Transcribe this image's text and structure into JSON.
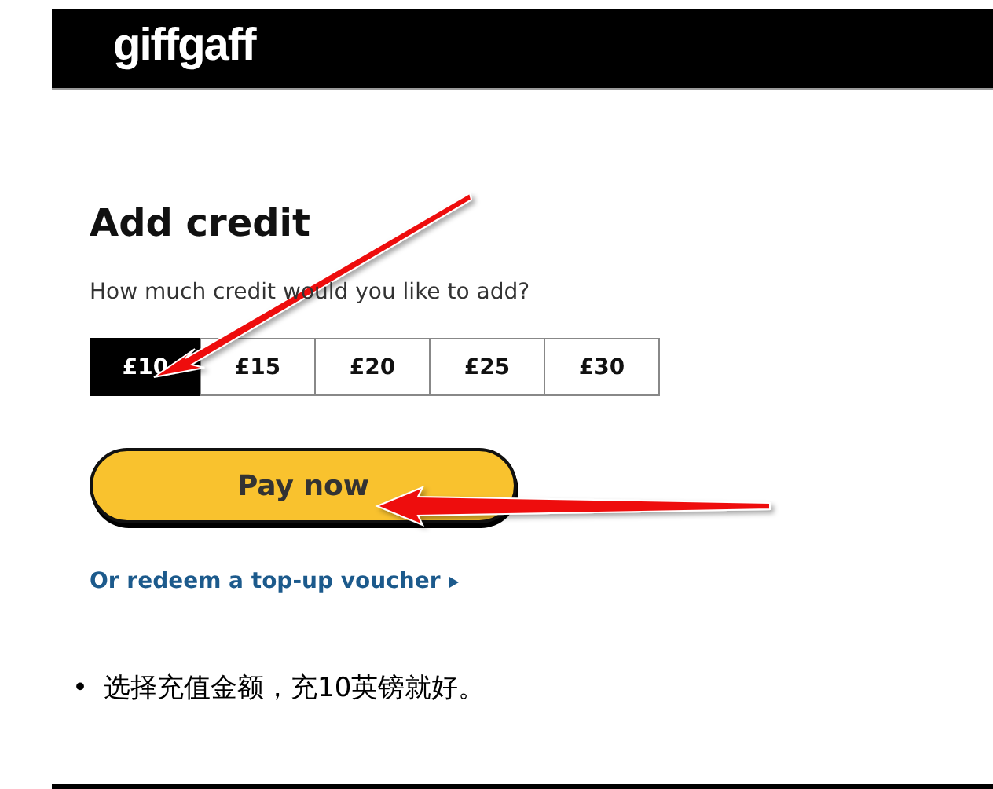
{
  "header": {
    "logo": "giffgaff"
  },
  "title": "Add credit",
  "question": "How much credit would you like to add?",
  "amounts": [
    {
      "label": "£10",
      "selected": true
    },
    {
      "label": "£15",
      "selected": false
    },
    {
      "label": "£20",
      "selected": false
    },
    {
      "label": "£25",
      "selected": false
    },
    {
      "label": "£30",
      "selected": false
    }
  ],
  "pay_button": "Pay now",
  "voucher_link": "Or redeem a top-up voucher",
  "notes": [
    {
      "bullet": "•",
      "text": "选择充值金额，充10英镑就好。"
    }
  ]
}
